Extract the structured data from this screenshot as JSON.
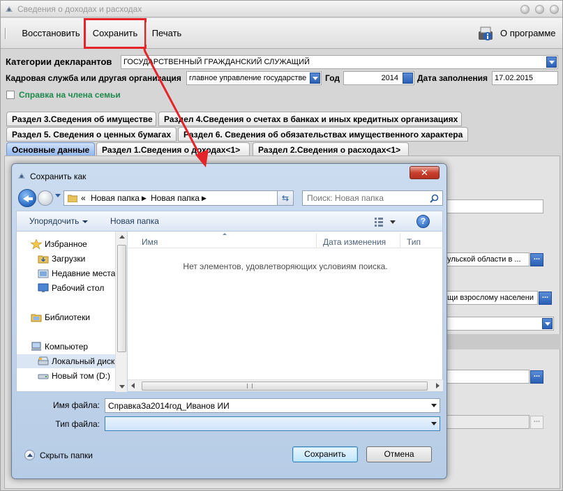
{
  "window": {
    "title": "Сведения о доходах и расходах"
  },
  "toolbar": {
    "restore_label": "Восстановить",
    "save_label": "Сохранить",
    "print_label": "Печать",
    "about_label": "О программе"
  },
  "form": {
    "category_label": "Категории декларантов",
    "category_value": "ГОСУДАРСТВЕННЫЙ ГРАЖДАНСКИЙ СЛУЖАЩИЙ",
    "hr_label": "Кадровая служба или другая организация",
    "hr_value": "главное управление государстве",
    "year_label": "Год",
    "year_value": "2014",
    "date_label": "Дата заполнения",
    "date_value": "17.02.2015",
    "family_checkbox_label": "Справка на члена семьи"
  },
  "tabs": {
    "row1": [
      "Раздел 3.Сведения об имуществе",
      "Раздел 4.Сведения о счетах в банках и иных кредитных организациях"
    ],
    "row2": [
      "Раздел 5. Сведения о ценных бумагах",
      "Раздел 6. Сведения об обязательствах имущественного характера"
    ],
    "row3": [
      "Основные данные",
      "Раздел 1.Сведения о доходах<1>",
      "Раздел 2.Сведения о расходах<1>"
    ]
  },
  "background_fields": {
    "org_partial": "Тульской области в ...",
    "service_partial": "ощи взрослому населени",
    "dots": "..."
  },
  "dialog": {
    "title": "Сохранить как",
    "close_symbol": "✕",
    "breadcrumb_prefix": "«",
    "breadcrumb": [
      "Новая папка",
      "Новая папка"
    ],
    "search_placeholder": "Поиск: Новая папка",
    "organize_label": "Упорядочить",
    "new_folder_label": "Новая папка",
    "help_symbol": "?",
    "nav_items": [
      {
        "label": "Избранное",
        "icon": "star-icon"
      },
      {
        "label": "Загрузки",
        "icon": "downloads-folder-icon"
      },
      {
        "label": "Недавние места",
        "icon": "recent-places-icon"
      },
      {
        "label": "Рабочий стол",
        "icon": "desktop-icon"
      },
      {
        "label": "Библиотеки",
        "icon": "libraries-icon"
      },
      {
        "label": "Компьютер",
        "icon": "computer-icon"
      },
      {
        "label": "Локальный диск",
        "icon": "local-disk-icon"
      },
      {
        "label": "Новый том (D:)",
        "icon": "drive-icon"
      }
    ],
    "columns": [
      "Имя",
      "Дата изменения",
      "Тип"
    ],
    "empty_message": "Нет элементов, удовлетворяющих условиям поиска.",
    "filename_label": "Имя файла:",
    "filename_value": "СправкаЗа2014год_Иванов ИИ",
    "filetype_label": "Тип файла:",
    "filetype_value": "",
    "hide_folders_label": "Скрыть папки",
    "save_button": "Сохранить",
    "cancel_button": "Отмена"
  },
  "colors": {
    "highlight_frame": "#e5242a",
    "annotation_arrow": "#e5242a",
    "accent_blue": "#2a5fb5",
    "dialog_frame": "#b7cce6",
    "family_label": "#1f8a4c"
  }
}
